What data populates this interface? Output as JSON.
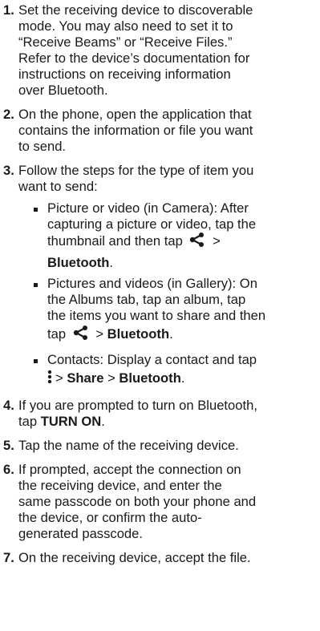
{
  "steps": [
    {
      "num": "1.",
      "lines": [
        "Set the receiving device to discoverable",
        "mode. You may also need to set it to",
        "“Receive Beams” or “Receive Files.”",
        "Refer to the device’s documentation for",
        "instructions on receiving information",
        "over Bluetooth."
      ]
    },
    {
      "num": "2.",
      "lines": [
        "On the phone, open the application that",
        "contains the information or file you want",
        "to send."
      ]
    },
    {
      "num": "3.",
      "lines": [
        "Follow the steps for the type of item you",
        "want to send:"
      ]
    },
    {
      "num": "4.",
      "lines": [
        "If you are prompted to turn on Bluetooth,"
      ],
      "last_prefix": "tap ",
      "last_bold": "TURN ON",
      "last_suffix": "."
    },
    {
      "num": "5.",
      "lines": [
        "Tap the name of the receiving device."
      ]
    },
    {
      "num": "6.",
      "lines": [
        "If prompted, accept the connection on",
        "the receiving device, and enter the",
        "same passcode on both your phone and",
        "the device, or confirm the auto-",
        "generated passcode."
      ]
    },
    {
      "num": "7.",
      "lines": [
        "On the receiving device, accept the file."
      ]
    }
  ],
  "substeps": {
    "camera": {
      "lines": [
        "Picture or video (in Camera): After",
        "capturing a picture or video, tap the"
      ],
      "l3_prefix": "thumbnail and then tap",
      "l3_gt": ">",
      "l4_bold": "Bluetooth",
      "l4_suffix": "."
    },
    "gallery": {
      "lines": [
        "Pictures and videos (in Gallery): On",
        "the Albums tab, tap an album, tap",
        "the items you want to share and then"
      ],
      "l4_prefix": "tap",
      "l4_gt": ">",
      "l4_bold": "Bluetooth",
      "l4_suffix": "."
    },
    "contacts": {
      "lines": [
        "Contacts: Display a contact and tap"
      ],
      "l2_gt1": ">",
      "l2_bold1": "Share",
      "l2_gt2": ">",
      "l2_bold2": "Bluetooth",
      "l2_suffix": "."
    }
  },
  "icons": {
    "share": "share-icon",
    "menu": "more-vertical-icon"
  }
}
